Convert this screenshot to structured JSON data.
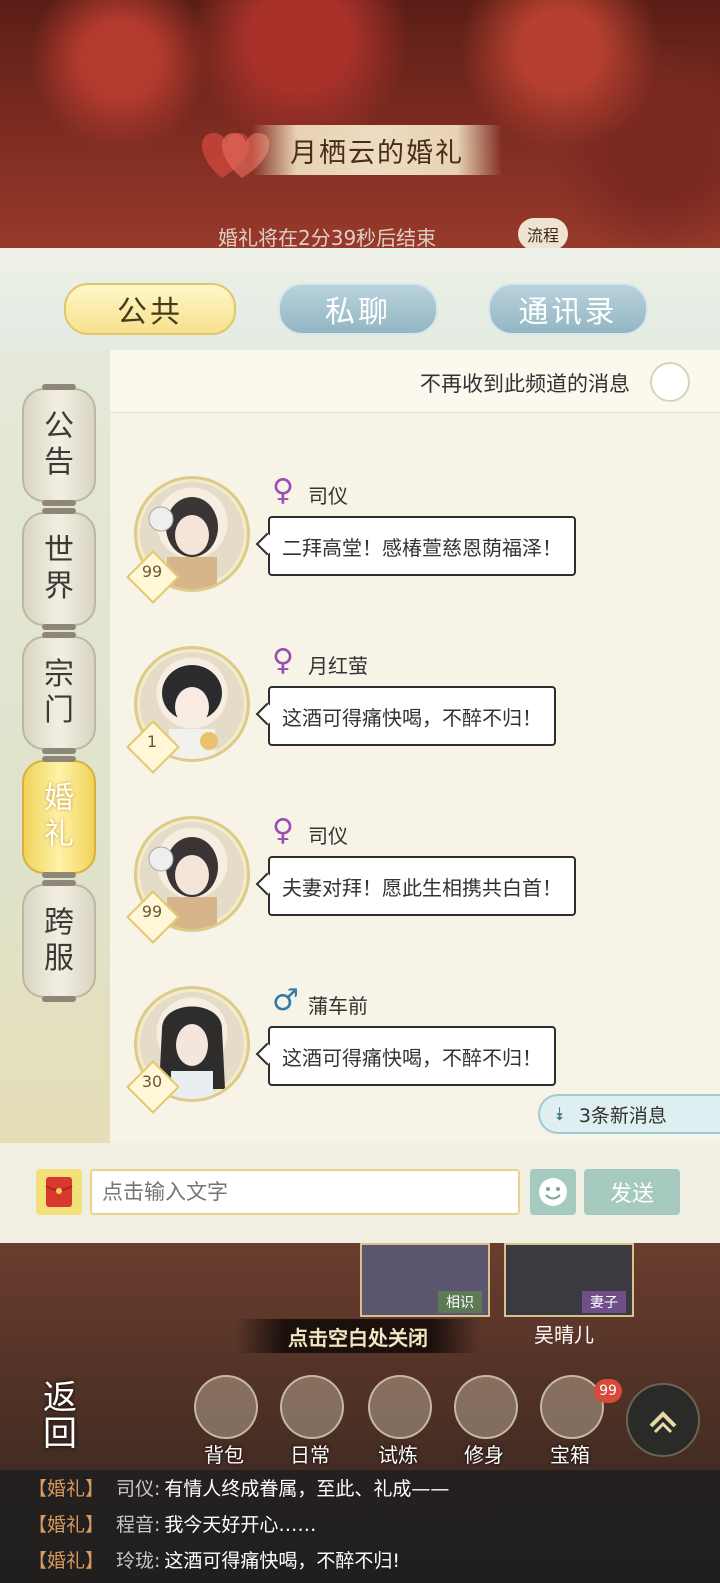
{
  "header": {
    "title": "月栖云的婚礼",
    "timer": "婚礼将在2分39秒后结束",
    "process_badge": "流程"
  },
  "tabs": [
    {
      "label": "公共",
      "active": true
    },
    {
      "label": "私聊",
      "active": false
    },
    {
      "label": "通讯录",
      "active": false
    }
  ],
  "channels": [
    {
      "label": "公告",
      "active": false
    },
    {
      "label": "世界",
      "active": false
    },
    {
      "label": "宗门",
      "active": false
    },
    {
      "label": "婚礼",
      "active": true
    },
    {
      "label": "跨服",
      "active": false
    }
  ],
  "mute": {
    "label": "不再收到此频道的消息",
    "checked": false
  },
  "messages": [
    {
      "sender": "司仪",
      "gender": "female",
      "gender_icon": "♀",
      "level": "99",
      "text": "二拜高堂！感椿萱慈恩荫福泽！"
    },
    {
      "sender": "月红萤",
      "gender": "female",
      "gender_icon": "♀",
      "level": "1",
      "text": "这酒可得痛快喝，不醉不归！"
    },
    {
      "sender": "司仪",
      "gender": "female",
      "gender_icon": "♀",
      "level": "99",
      "text": "夫妻对拜！愿此生相携共白首！"
    },
    {
      "sender": "蒲车前",
      "gender": "male",
      "gender_icon": "♂",
      "level": "30",
      "text": "这酒可得痛快喝，不醉不归！"
    }
  ],
  "new_messages": {
    "label": "3条新消息",
    "icon": "double-chevron-down"
  },
  "input": {
    "placeholder": "点击输入文字",
    "value": "",
    "send_label": "发送"
  },
  "scene": {
    "partner_tag_1": "相识",
    "partner_tag_2": "妻子",
    "partner_name": "吴晴儿",
    "close_hint": "点击空白处关闭",
    "back_label_1": "返",
    "back_label_2": "回"
  },
  "dock": [
    {
      "label": "背包"
    },
    {
      "label": "日常"
    },
    {
      "label": "试炼"
    },
    {
      "label": "修身"
    },
    {
      "label": "宝箱"
    }
  ],
  "dock_badge": "99",
  "feed": [
    {
      "tag": "【婚礼】",
      "sender": "司仪:",
      "text": "有情人终成眷属，至此、礼成——"
    },
    {
      "tag": "【婚礼】",
      "sender": "程音:",
      "text": "我今天好开心……"
    },
    {
      "tag": "【婚礼】",
      "sender": "玲珑:",
      "text": "这酒可得痛快喝，不醉不归!"
    }
  ],
  "colors": {
    "accent_gold": "#f6e18e",
    "accent_teal": "#93b6c4",
    "female": "#9a4fb0",
    "male": "#2f79ae"
  }
}
